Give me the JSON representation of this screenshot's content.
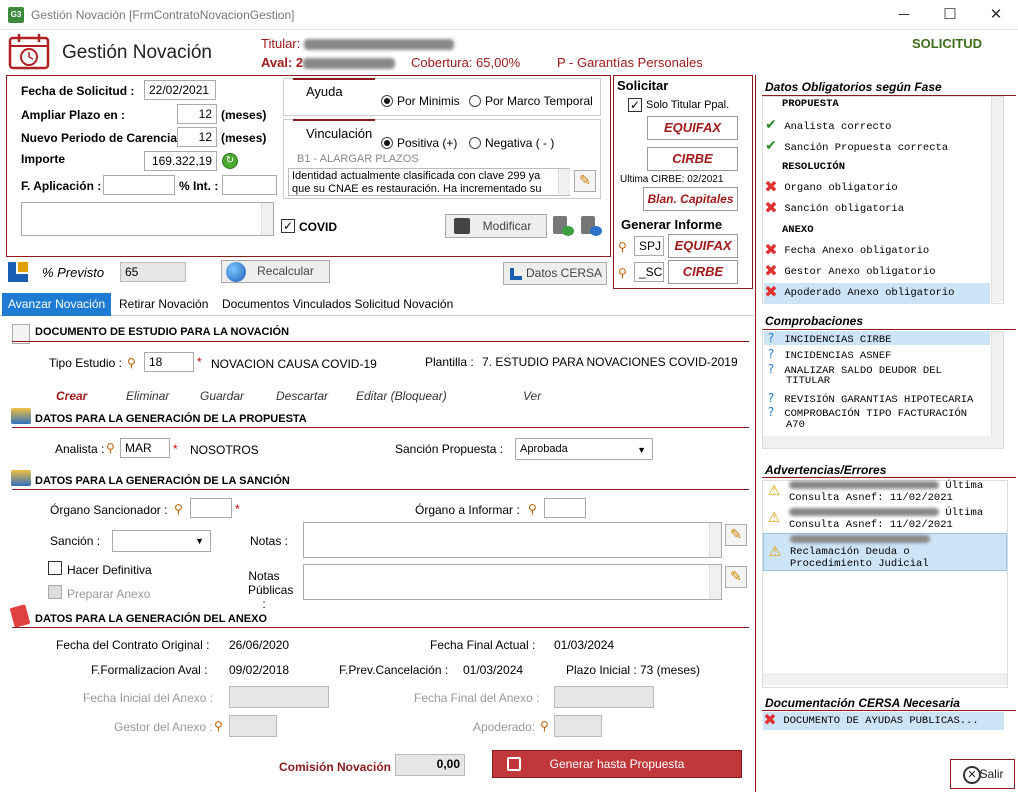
{
  "window": {
    "title": "Gestión Novación [FrmContratoNovacionGestion]",
    "app_icon": "G3"
  },
  "header": {
    "title": "Gestión Novación",
    "titular_label": "Titular:",
    "aval_label": "Aval: 2",
    "cobertura": "Cobertura: 65,00%",
    "garantia": "P - Garantías Personales",
    "status": "SOLICITUD"
  },
  "form": {
    "fecha_solicitud_label": "Fecha de Solicitud :",
    "fecha_solicitud": "22/02/2021",
    "ampliar_plazo_label": "Ampliar Plazo en :",
    "ampliar_plazo": "12",
    "meses1": "(meses)",
    "carencia_label": "Nuevo Periodo de Carencia :",
    "carencia": "12",
    "meses2": "(meses)",
    "importe_label": "Importe",
    "importe": "169.322,19",
    "f_aplicacion_label": "F. Aplicación :",
    "int_label": "% Int. :",
    "covid_label": "COVID",
    "previsto_label": "% Previsto",
    "previsto": "65",
    "recalcular": "Recalcular",
    "datos_cersa": "Datos CERSA"
  },
  "ayuda": {
    "label": "Ayuda",
    "opt1": "Por Minimis",
    "opt2": "Por Marco Temporal"
  },
  "vinculacion": {
    "label": "Vinculación",
    "opt1": "Positiva (+)",
    "opt2": "Negativa ( - )",
    "code": "B1 - ALARGAR PLAZOS",
    "text_line1": "Identidad actualmente clasificada con clave 299 ya",
    "text_line2": "que su CNAE es restauración. Ha incrementado su",
    "modificar": "Modificar"
  },
  "solicitar": {
    "label": "Solicitar",
    "solo_titular": "Solo Titular Ppal.",
    "equifax": "EQUIFAX",
    "cirbe": "CIRBE",
    "ultima_cirbe": "Ultima CIRBE: 02/2021",
    "blan_capitales": "Blan. Capitales",
    "generar_informe": "Generar Informe",
    "spj": "SPJ",
    "equifax2": "EQUIFAX",
    "sc": "_SC",
    "cirbe2": "CIRBE"
  },
  "tabs": [
    "Avanzar Novación",
    "Retirar Novación",
    "Documentos Vinculados Solicitud Novación"
  ],
  "estudio": {
    "section": "DOCUMENTO DE ESTUDIO PARA LA NOVACIÓN",
    "tipo_label": "Tipo Estudio :",
    "tipo_value": "18",
    "tipo_desc": "NOVACION CAUSA COVID-19",
    "plantilla_label": "Plantilla :",
    "plantilla_value": "7. ESTUDIO PARA  NOVACIONES COVID-2019",
    "actions": [
      "Crear",
      "Eliminar",
      "Guardar",
      "Descartar",
      "Editar (Bloquear)",
      "Ver"
    ]
  },
  "propuesta": {
    "section": "DATOS PARA LA GENERACIÓN DE LA PROPUESTA",
    "analista_label": "Analista :",
    "analista_value": "MAR",
    "analista_desc": "NOSOTROS",
    "sancion_label": "Sanción Propuesta :",
    "sancion_value": "Aprobada"
  },
  "sancion": {
    "section": "DATOS PARA LA GENERACIÓN DE LA SANCIÓN",
    "organo_label": "Órgano Sancionador :",
    "organo_informar_label": "Órgano a Informar :",
    "sancion_label": "Sanción :",
    "notas_label": "Notas :",
    "notas_publicas_label1": "Notas",
    "notas_publicas_label2": "Públicas :",
    "hacer_definitiva": "Hacer Definitiva",
    "preparar_anexo": "Preparar Anexo"
  },
  "anexo": {
    "section": "DATOS PARA LA GENERACIÓN DEL ANEXO",
    "fecha_contrato_label": "Fecha del Contrato Original :",
    "fecha_contrato": "26/06/2020",
    "fecha_final_label": "Fecha Final Actual :",
    "fecha_final": "01/03/2024",
    "formalizacion_label": "F.Formalizacion Aval :",
    "formalizacion": "09/02/2018",
    "cancelacion_label": "F.Prev.Cancelación :",
    "cancelacion": "01/03/2024",
    "plazo_label": "Plazo Inicial :",
    "plazo": "73 (meses)",
    "fecha_inicial_anexo_label": "Fecha Inicial del Anexo :",
    "fecha_final_anexo_label": "Fecha Final del Anexo :",
    "gestor_label": "Gestor del Anexo :",
    "apoderado_label": "Apoderado:"
  },
  "footer": {
    "comision_label": "Comisión Novación",
    "comision": "0,00",
    "generar": "Generar hasta Propuesta",
    "salir": "Salir"
  },
  "obligatorios": {
    "title": "Datos Obligatorios según Fase",
    "items": [
      {
        "type": "head",
        "text": "PROPUESTA"
      },
      {
        "type": "ok",
        "text": "Analista correcto"
      },
      {
        "type": "ok",
        "text": "Sanción Propuesta correcta"
      },
      {
        "type": "head",
        "text": "RESOLUCIÓN"
      },
      {
        "type": "err",
        "text": "Organo obligatorio"
      },
      {
        "type": "err",
        "text": "Sanción obligatoria"
      },
      {
        "type": "head",
        "text": "ANEXO"
      },
      {
        "type": "err",
        "text": "Fecha Anexo obligatorio"
      },
      {
        "type": "err",
        "text": "Gestor Anexo obligatorio"
      },
      {
        "type": "err",
        "text": "Apoderado Anexo obligatorio"
      }
    ]
  },
  "comprobaciones": {
    "title": "Comprobaciones",
    "items": [
      "INCIDENCIAS CIRBE",
      "INCIDENCIAS ASNEF",
      "ANALIZAR SALDO DEUDOR DEL",
      "TITULAR",
      "REVISIÓN GARANTIAS HIPOTECARIA",
      "COMPROBACIÓN TIPO FACTURACIÓN",
      "A70"
    ]
  },
  "advertencias": {
    "title": "Advertencias/Errores",
    "items": [
      {
        "line1": "Última",
        "line2": "Consulta Asnef: 11/02/2021"
      },
      {
        "line1": "Última",
        "line2": "Consulta Asnef: 11/02/2021"
      },
      {
        "line1": "Reclamación Deuda o",
        "line2": "Procedimiento Judicial"
      }
    ]
  },
  "documentacion": {
    "title": "Documentación CERSA Necesaria",
    "item": "DOCUMENTO DE AYUDAS  PUBLICAS..."
  }
}
